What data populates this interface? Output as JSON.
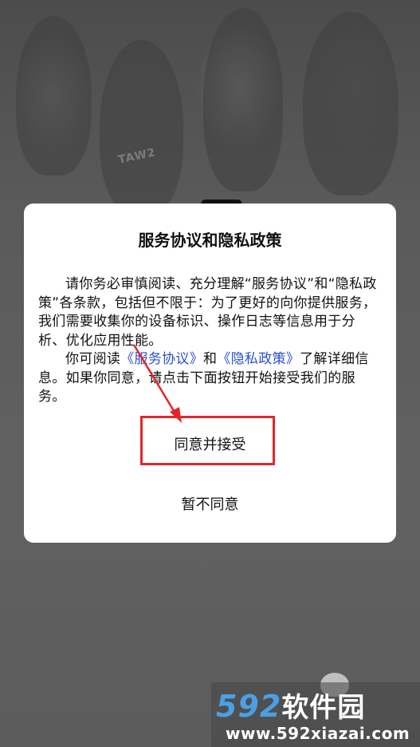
{
  "background": {
    "stamp_text": "TAW2"
  },
  "dialog": {
    "title": "服务协议和隐私政策",
    "paragraph1": "请你务必审慎阅读、充分理解“服务协议”和“隐私政策”各条款，包括但不限于：为了更好的向你提供服务，我们需要收集你的设备标识、操作日志等信息用于分析、优化应用性能。",
    "paragraph2_prefix": "你可阅读",
    "service_link": "《服务协议》",
    "and_text": "和",
    "privacy_link": "《隐私政策》",
    "paragraph2_suffix": "了解详细信息。如果你同意，请点击下面按钮开始接受我们的服务。",
    "accept_label": "同意并接受",
    "decline_label": "暂不同意"
  },
  "watermark": {
    "brand_number": "592",
    "brand_text": "软件园",
    "url": "www.592xiazai.com"
  },
  "colors": {
    "link": "#2a4fd3",
    "highlight": "#e2262b",
    "brand": "#4aa0e6"
  }
}
